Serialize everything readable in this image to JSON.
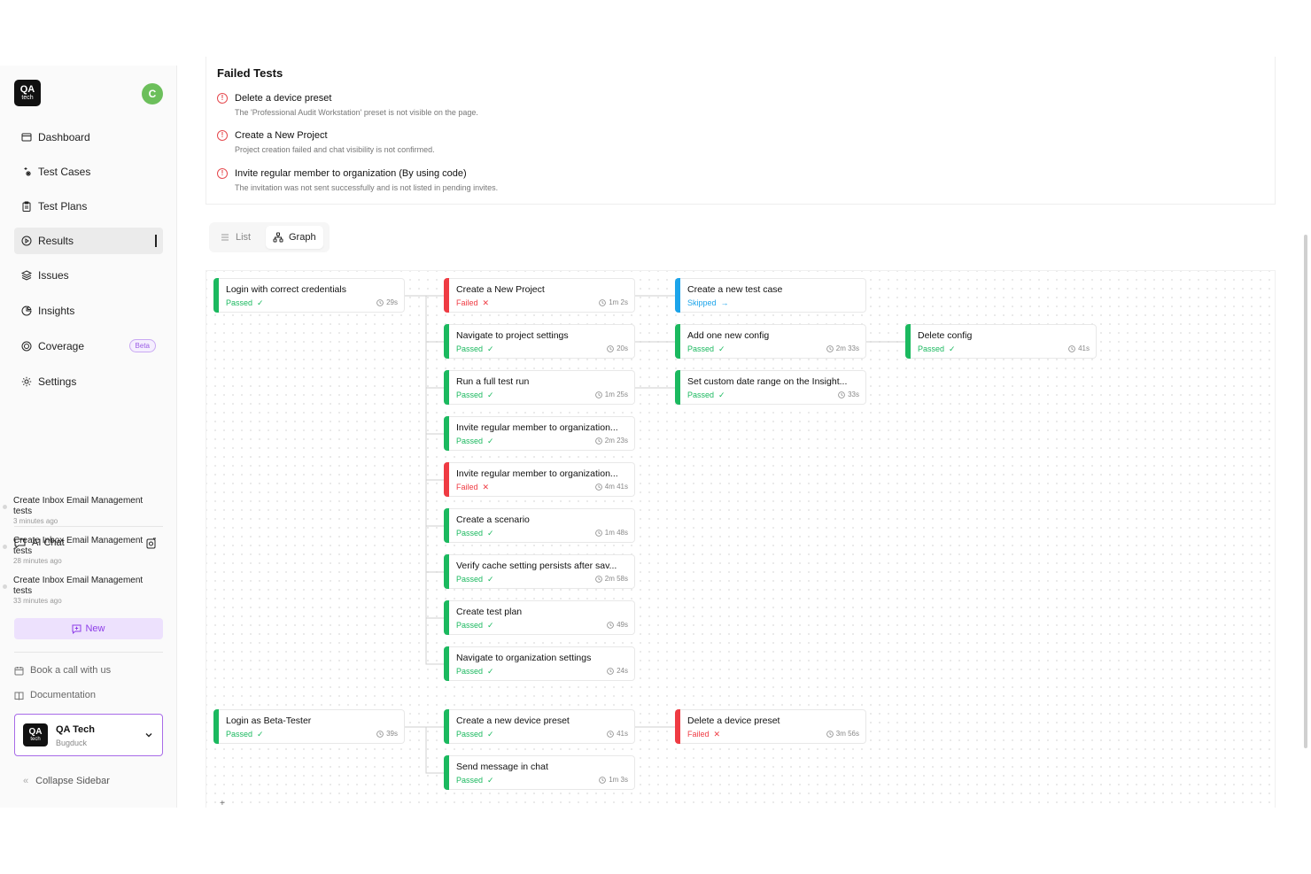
{
  "brand": {
    "logo_line1": "QA",
    "logo_line2": "tech"
  },
  "user": {
    "avatar_initial": "C"
  },
  "nav": {
    "dashboard": "Dashboard",
    "test_cases": "Test Cases",
    "test_plans": "Test Plans",
    "results": "Results",
    "issues": "Issues",
    "insights": "Insights",
    "coverage": "Coverage",
    "coverage_badge": "Beta",
    "settings": "Settings"
  },
  "ai_chat": {
    "title": "AI Chat",
    "items": [
      {
        "title": "Create Inbox Email Management tests",
        "time": "3 minutes ago"
      },
      {
        "title": "Create Inbox Email Management tests",
        "time": "28 minutes ago"
      },
      {
        "title": "Create Inbox Email Management tests",
        "time": "33 minutes ago"
      }
    ],
    "new_label": "New"
  },
  "links": {
    "book_call": "Book a call with us",
    "documentation": "Documentation"
  },
  "org": {
    "name": "QA Tech",
    "project": "Bugduck"
  },
  "collapse_label": "Collapse Sidebar",
  "failed_tests": {
    "title": "Failed Tests",
    "items": [
      {
        "name": "Delete a device preset",
        "reason": "The 'Professional Audit Workstation' preset is not visible on the page."
      },
      {
        "name": "Create a New Project",
        "reason": "Project creation failed and chat visibility is not confirmed."
      },
      {
        "name": "Invite regular member to organization (By using code)",
        "reason": "The invitation was not sent successfully and is not listed in pending invites."
      }
    ]
  },
  "view_toggle": {
    "list": "List",
    "graph": "Graph"
  },
  "colors": {
    "passed": "#1bb95f",
    "failed": "#ef3b43",
    "skipped": "#1ca4ea",
    "accent": "#8e3ee8"
  },
  "graph": {
    "nodes": [
      {
        "title": "Login with correct credentials",
        "status": "Passed",
        "duration": "29s"
      },
      {
        "title": "Create a New Project",
        "status": "Failed",
        "duration": "1m 2s"
      },
      {
        "title": "Navigate to project settings",
        "status": "Passed",
        "duration": "20s"
      },
      {
        "title": "Run a full test run",
        "status": "Passed",
        "duration": "1m 25s"
      },
      {
        "title": "Invite regular member to organization...",
        "status": "Passed",
        "duration": "2m 23s"
      },
      {
        "title": "Invite regular member to organization...",
        "status": "Failed",
        "duration": "4m 41s"
      },
      {
        "title": "Create a scenario",
        "status": "Passed",
        "duration": "1m 48s"
      },
      {
        "title": "Verify cache setting persists after sav...",
        "status": "Passed",
        "duration": "2m 58s"
      },
      {
        "title": "Create test plan",
        "status": "Passed",
        "duration": "49s"
      },
      {
        "title": "Navigate to organization settings",
        "status": "Passed",
        "duration": "24s"
      },
      {
        "title": "Create a new test case",
        "status": "Skipped",
        "duration": ""
      },
      {
        "title": "Add one new config",
        "status": "Passed",
        "duration": "2m 33s"
      },
      {
        "title": "Set custom date range on the Insight...",
        "status": "Passed",
        "duration": "33s"
      },
      {
        "title": "Delete config",
        "status": "Passed",
        "duration": "41s"
      },
      {
        "title": "Login as Beta-Tester",
        "status": "Passed",
        "duration": "39s"
      },
      {
        "title": "Create a new device preset",
        "status": "Passed",
        "duration": "41s"
      },
      {
        "title": "Send message in chat",
        "status": "Passed",
        "duration": "1m 3s"
      },
      {
        "title": "Delete a device preset",
        "status": "Failed",
        "duration": "3m 56s"
      }
    ]
  }
}
